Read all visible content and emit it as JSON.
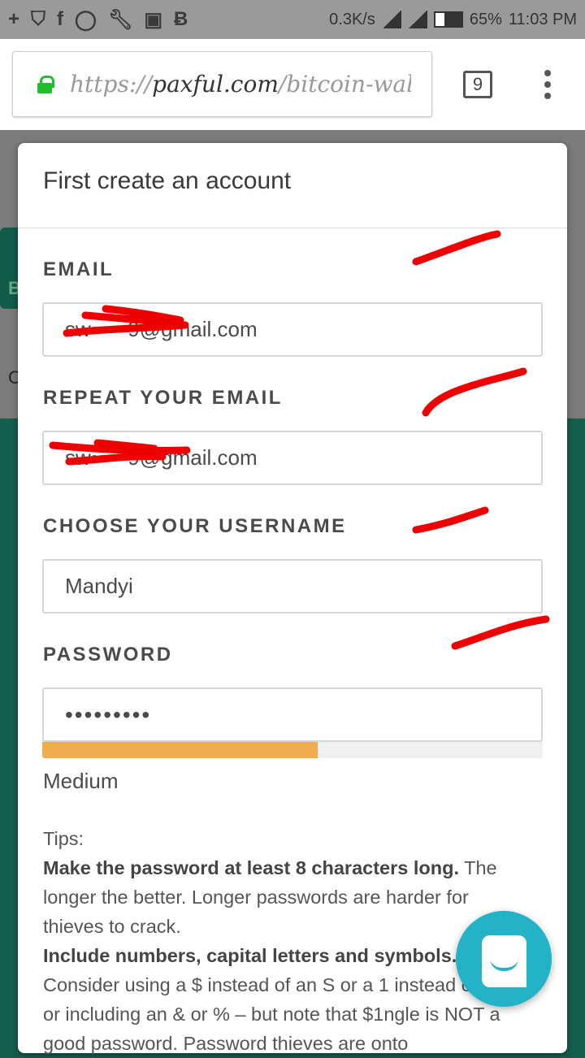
{
  "status_bar": {
    "left_icons": [
      "plus-icon",
      "shield-icon",
      "facebook-icon",
      "whatsapp-icon",
      "wrench-icon",
      "image-icon",
      "bitcoin-icon"
    ],
    "network_speed": "0.3K/s",
    "network_type": "H+",
    "battery": "65%",
    "battery_level": 0.65,
    "time": "11:03 PM"
  },
  "browser": {
    "url_scheme": "https://",
    "url_host": "paxful.com",
    "url_path": "/bitcoin-walle",
    "tab_count": "9"
  },
  "background": {
    "button_letter": "B",
    "text_letter": "C"
  },
  "modal": {
    "title": "First create an account",
    "email_label": "EMAIL",
    "email_value": "sw•••••9@gmail.com",
    "repeat_email_label": "REPEAT YOUR EMAIL",
    "repeat_email_value": "sw•••••9@gmail.com",
    "username_label": "CHOOSE YOUR USERNAME",
    "username_value": "Mandyi",
    "password_label": "PASSWORD",
    "password_value": "•••••••••",
    "strength_percent": 55,
    "strength_color": "#f0ad4e",
    "strength_label": "Medium",
    "tips": {
      "heading": "Tips:",
      "tip1_bold": "Make the password at least 8 characters long.",
      "tip1_text": " The longer the better. Longer passwords are harder for thieves to crack.",
      "tip2_bold": "Include numbers, capital letters and symbols.",
      "tip2_text": " Consider using a $ instead of an S or a 1 instead of an L, or including an & or % – but note that $1ngle is NOT a good password. Password thieves are onto"
    }
  },
  "chat_button": {
    "icon": "chat-smile-icon",
    "color": "#22b3c6"
  }
}
